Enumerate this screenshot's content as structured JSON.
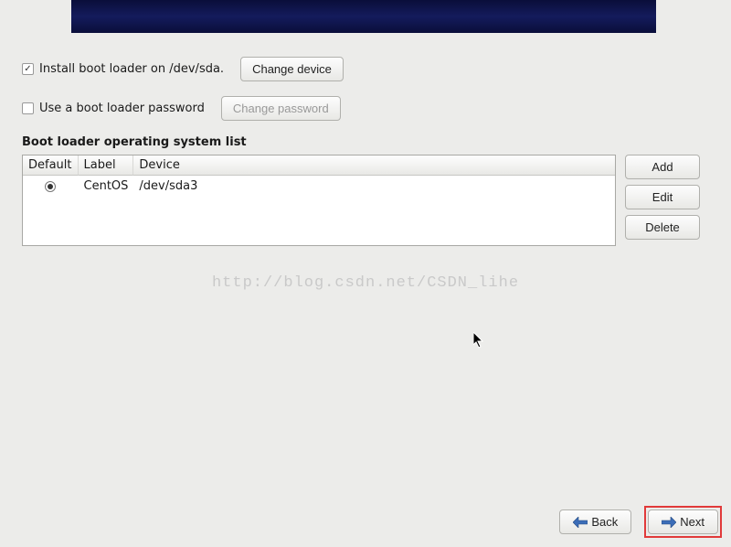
{
  "options": {
    "install_boot_loader": {
      "checked": true,
      "label": "Install boot loader on /dev/sda.",
      "button": "Change device"
    },
    "use_password": {
      "checked": false,
      "label": "Use a boot loader password",
      "button": "Change password"
    }
  },
  "section_title": "Boot loader operating system list",
  "table": {
    "headers": {
      "default": "Default",
      "label": "Label",
      "device": "Device"
    },
    "rows": [
      {
        "default": true,
        "label": "CentOS",
        "device": "/dev/sda3"
      }
    ]
  },
  "side_buttons": {
    "add": "Add",
    "edit": "Edit",
    "delete": "Delete"
  },
  "watermark": "http://blog.csdn.net/CSDN_lihe",
  "footer": {
    "back": "Back",
    "next": "Next"
  }
}
